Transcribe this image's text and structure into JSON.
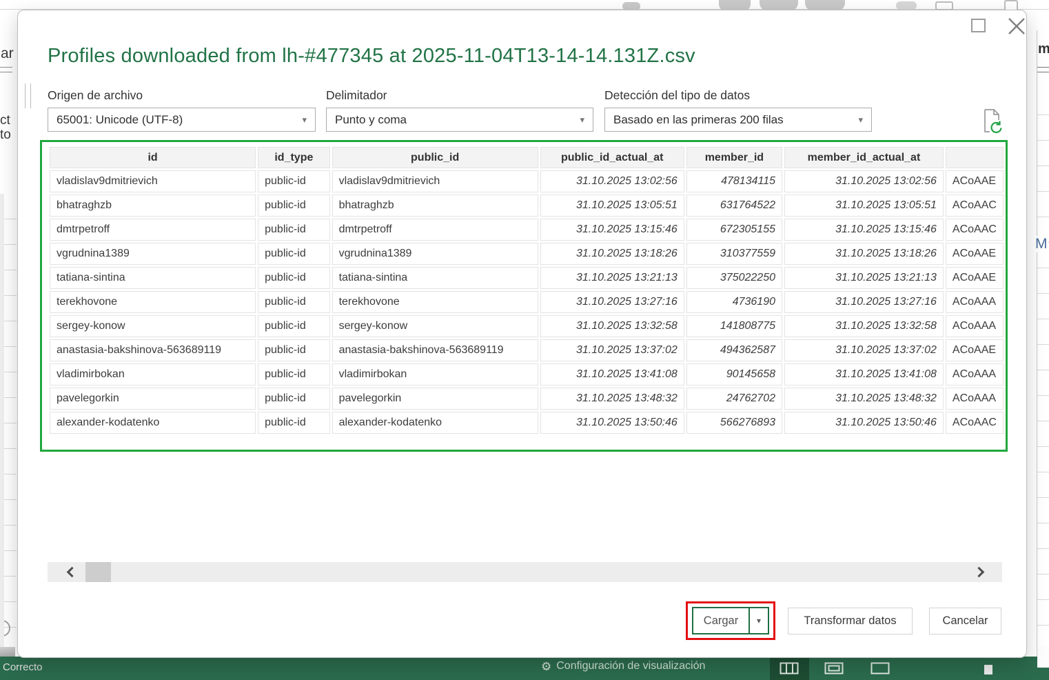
{
  "dialog": {
    "title": "Profiles downloaded from lh-#477345 at 2025-11-04T13-14-14.131Z.csv",
    "fields": [
      {
        "label": "Origen de archivo",
        "value": "65001: Unicode (UTF-8)"
      },
      {
        "label": "Delimitador",
        "value": "Punto y coma"
      },
      {
        "label": "Detección del tipo de datos",
        "value": "Basado en las primeras 200 filas"
      }
    ],
    "buttons": {
      "load": "Cargar",
      "transform": "Transformar datos",
      "cancel": "Cancelar"
    }
  },
  "table": {
    "columns": [
      {
        "label": "id",
        "align": "left",
        "italic": false
      },
      {
        "label": "id_type",
        "align": "left",
        "italic": false
      },
      {
        "label": "public_id",
        "align": "left",
        "italic": false
      },
      {
        "label": "public_id_actual_at",
        "align": "right",
        "italic": true
      },
      {
        "label": "member_id",
        "align": "right",
        "italic": true
      },
      {
        "label": "member_id_actual_at",
        "align": "right",
        "italic": true
      },
      {
        "label": "",
        "align": "left",
        "italic": false
      }
    ],
    "rows": [
      [
        "vladislav9dmitrievich",
        "public-id",
        "vladislav9dmitrievich",
        "31.10.2025 13:02:56",
        "478134115",
        "31.10.2025 13:02:56",
        "ACoAAE"
      ],
      [
        "bhatraghzb",
        "public-id",
        "bhatraghzb",
        "31.10.2025 13:05:51",
        "631764522",
        "31.10.2025 13:05:51",
        "ACoAAC"
      ],
      [
        "dmtrpetroff",
        "public-id",
        "dmtrpetroff",
        "31.10.2025 13:15:46",
        "672305155",
        "31.10.2025 13:15:46",
        "ACoAAC"
      ],
      [
        "vgrudnina1389",
        "public-id",
        "vgrudnina1389",
        "31.10.2025 13:18:26",
        "310377559",
        "31.10.2025 13:18:26",
        "ACoAAE"
      ],
      [
        "tatiana-sintina",
        "public-id",
        "tatiana-sintina",
        "31.10.2025 13:21:13",
        "375022250",
        "31.10.2025 13:21:13",
        "ACoAAE"
      ],
      [
        "terekhovone",
        "public-id",
        "terekhovone",
        "31.10.2025 13:27:16",
        "4736190",
        "31.10.2025 13:27:16",
        "ACoAAA"
      ],
      [
        "sergey-konow",
        "public-id",
        "sergey-konow",
        "31.10.2025 13:32:58",
        "141808775",
        "31.10.2025 13:32:58",
        "ACoAAA"
      ],
      [
        "anastasia-bakshinova-563689119",
        "public-id",
        "anastasia-bakshinova-563689119",
        "31.10.2025 13:37:02",
        "494362587",
        "31.10.2025 13:37:02",
        "ACoAAE"
      ],
      [
        "vladimirbokan",
        "public-id",
        "vladimirbokan",
        "31.10.2025 13:41:08",
        "90145658",
        "31.10.2025 13:41:08",
        "ACoAAA"
      ],
      [
        "pavelegorkin",
        "public-id",
        "pavelegorkin",
        "31.10.2025 13:48:32",
        "24762702",
        "31.10.2025 13:48:32",
        "ACoAAA"
      ],
      [
        "alexander-kodatenko",
        "public-id",
        "alexander-kodatenko",
        "31.10.2025 13:50:46",
        "566276893",
        "31.10.2025 13:50:46",
        "ACoAAC"
      ]
    ]
  },
  "background": {
    "fragments": {
      "top_left": "ar",
      "mid_left_1": "ct",
      "mid_left_2": "to",
      "top_right": "m",
      "mid_right": "M"
    },
    "status_bar": {
      "ready": "Correcto",
      "display_settings": "Configuración de visualización"
    }
  },
  "icons": {
    "combo_arrow": "▾",
    "gear": "⚙"
  },
  "colors": {
    "excel_green": "#217346",
    "table_annotation_green": "#20a83e",
    "button_annotation_red": "#e30f12",
    "status_bar_green": "#2b6b4d"
  }
}
